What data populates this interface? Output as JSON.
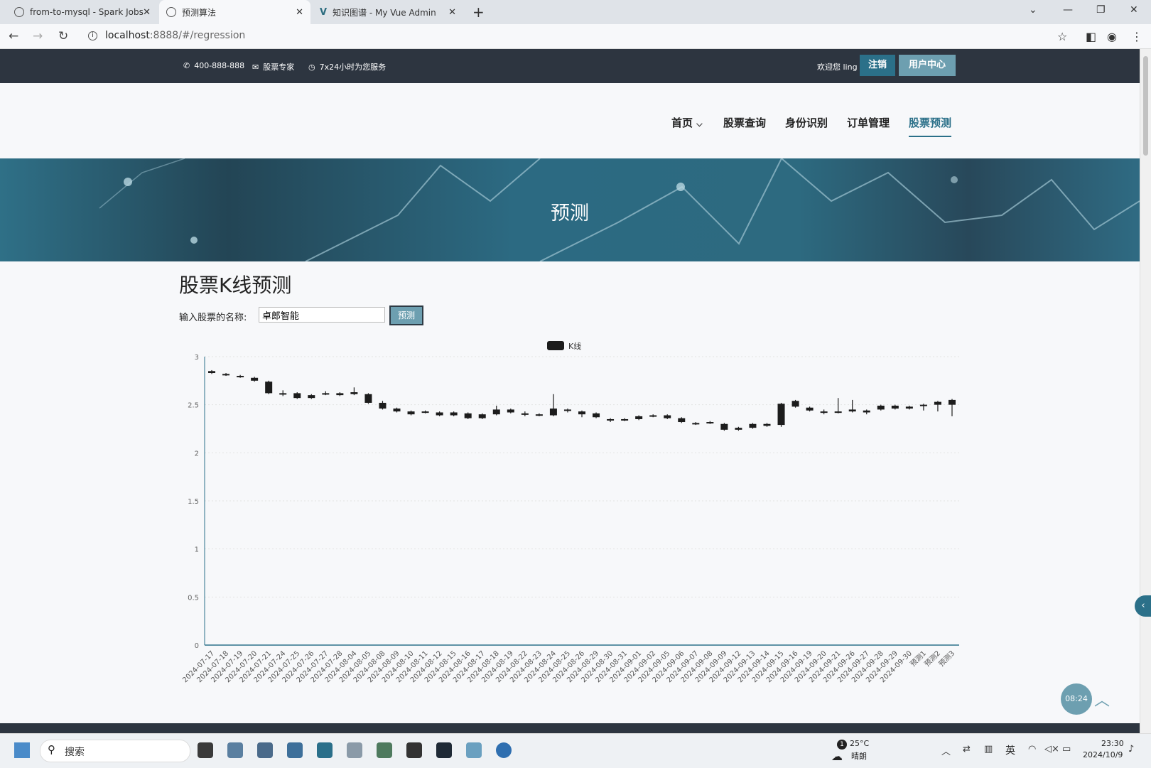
{
  "browser": {
    "tabs": [
      {
        "title": "from-to-mysql - Spark Jobs",
        "active": false
      },
      {
        "title": "预测算法",
        "active": true
      },
      {
        "title": "知识图谱 - My Vue Admin",
        "active": false
      }
    ],
    "url_host": "localhost",
    "url_rest": ":8888/#/regression"
  },
  "topbar": {
    "phone": "400-888-888",
    "expert": "股票专家",
    "service": "7x24小时为您服务",
    "welcome": "欢迎您 ling",
    "logout_label": "注销",
    "user_center_label": "用户中心"
  },
  "nav": {
    "items": [
      {
        "label": "首页",
        "active": false
      },
      {
        "label": "股票查询",
        "active": false
      },
      {
        "label": "身份识别",
        "active": false
      },
      {
        "label": "订单管理",
        "active": false
      },
      {
        "label": "股票预测",
        "active": true
      }
    ]
  },
  "banner": {
    "title": "预测"
  },
  "main": {
    "title": "股票K线预测",
    "input_label": "输入股票的名称:",
    "input_value": "卓郎智能",
    "predict_button": "预测"
  },
  "chart_data": {
    "type": "candlestick",
    "legend": [
      "K线"
    ],
    "ylim": [
      0,
      3
    ],
    "yticks": [
      "0",
      "0.5",
      "1",
      "1.5",
      "2",
      "2.5",
      "3"
    ],
    "color": "#1c1c1c",
    "categories": [
      "2024-07-17",
      "2024-07-18",
      "2024-07-19",
      "2024-07-20",
      "2024-07-21",
      "2024-07-24",
      "2024-07-25",
      "2024-07-26",
      "2024-07-27",
      "2024-07-28",
      "2024-08-04",
      "2024-08-05",
      "2024-08-08",
      "2024-08-09",
      "2024-08-10",
      "2024-08-11",
      "2024-08-12",
      "2024-08-15",
      "2024-08-16",
      "2024-08-17",
      "2024-08-18",
      "2024-08-19",
      "2024-08-22",
      "2024-08-23",
      "2024-08-24",
      "2024-08-25",
      "2024-08-26",
      "2024-08-29",
      "2024-08-30",
      "2024-08-31",
      "2024-09-01",
      "2024-09-02",
      "2024-09-05",
      "2024-09-06",
      "2024-09-07",
      "2024-09-08",
      "2024-09-09",
      "2024-09-12",
      "2024-09-13",
      "2024-09-14",
      "2024-09-15",
      "2024-09-16",
      "2024-09-19",
      "2024-09-20",
      "2024-09-21",
      "2024-09-26",
      "2024-09-27",
      "2024-09-28",
      "2024-09-29",
      "2024-09-30",
      "预测1",
      "预测2",
      "预测3"
    ],
    "series": [
      [
        2.83,
        2.85,
        2.82,
        2.86
      ],
      [
        2.82,
        2.81,
        2.8,
        2.83
      ],
      [
        2.8,
        2.79,
        2.78,
        2.81
      ],
      [
        2.78,
        2.75,
        2.74,
        2.79
      ],
      [
        2.74,
        2.62,
        2.61,
        2.75
      ],
      [
        2.62,
        2.61,
        2.59,
        2.65
      ],
      [
        2.62,
        2.57,
        2.56,
        2.63
      ],
      [
        2.57,
        2.6,
        2.56,
        2.61
      ],
      [
        2.61,
        2.62,
        2.6,
        2.64
      ],
      [
        2.62,
        2.6,
        2.59,
        2.63
      ],
      [
        2.63,
        2.61,
        2.6,
        2.68
      ],
      [
        2.61,
        2.52,
        2.51,
        2.62
      ],
      [
        2.52,
        2.46,
        2.45,
        2.54
      ],
      [
        2.46,
        2.43,
        2.42,
        2.47
      ],
      [
        2.43,
        2.4,
        2.39,
        2.44
      ],
      [
        2.42,
        2.43,
        2.41,
        2.44
      ],
      [
        2.42,
        2.39,
        2.38,
        2.43
      ],
      [
        2.39,
        2.42,
        2.38,
        2.43
      ],
      [
        2.41,
        2.36,
        2.35,
        2.42
      ],
      [
        2.36,
        2.4,
        2.35,
        2.41
      ],
      [
        2.4,
        2.45,
        2.39,
        2.49
      ],
      [
        2.45,
        2.42,
        2.41,
        2.46
      ],
      [
        2.41,
        2.4,
        2.38,
        2.43
      ],
      [
        2.39,
        2.4,
        2.38,
        2.41
      ],
      [
        2.39,
        2.46,
        2.38,
        2.61
      ],
      [
        2.44,
        2.45,
        2.42,
        2.46
      ],
      [
        2.43,
        2.4,
        2.37,
        2.44
      ],
      [
        2.41,
        2.37,
        2.36,
        2.42
      ],
      [
        2.35,
        2.34,
        2.32,
        2.36
      ],
      [
        2.34,
        2.35,
        2.33,
        2.36
      ],
      [
        2.35,
        2.38,
        2.34,
        2.39
      ],
      [
        2.38,
        2.39,
        2.37,
        2.4
      ],
      [
        2.39,
        2.36,
        2.35,
        2.4
      ],
      [
        2.36,
        2.32,
        2.31,
        2.37
      ],
      [
        2.31,
        2.31,
        2.29,
        2.32
      ],
      [
        2.31,
        2.32,
        2.3,
        2.33
      ],
      [
        2.3,
        2.24,
        2.23,
        2.31
      ],
      [
        2.24,
        2.26,
        2.23,
        2.27
      ],
      [
        2.26,
        2.3,
        2.25,
        2.31
      ],
      [
        2.28,
        2.3,
        2.27,
        2.31
      ],
      [
        2.29,
        2.51,
        2.27,
        2.52
      ],
      [
        2.48,
        2.54,
        2.47,
        2.55
      ],
      [
        2.47,
        2.44,
        2.43,
        2.48
      ],
      [
        2.43,
        2.43,
        2.4,
        2.45
      ],
      [
        2.42,
        2.43,
        2.41,
        2.57
      ],
      [
        2.43,
        2.45,
        2.42,
        2.55
      ],
      [
        2.44,
        2.42,
        2.4,
        2.45
      ],
      [
        2.45,
        2.49,
        2.44,
        2.5
      ],
      [
        2.49,
        2.46,
        2.45,
        2.5
      ],
      [
        2.46,
        2.48,
        2.45,
        2.49
      ],
      [
        2.49,
        2.5,
        2.44,
        2.51
      ],
      [
        2.5,
        2.53,
        2.43,
        2.54
      ],
      [
        2.5,
        2.55,
        2.38,
        2.56
      ]
    ]
  },
  "widgets": {
    "timer": "08:24"
  },
  "taskbar": {
    "search_label": "搜索",
    "weather_temp": "25°C",
    "weather_desc": "晴朗",
    "weather_badge": "1",
    "ime": "英",
    "time": "23:30",
    "date": "2024/10/9"
  }
}
